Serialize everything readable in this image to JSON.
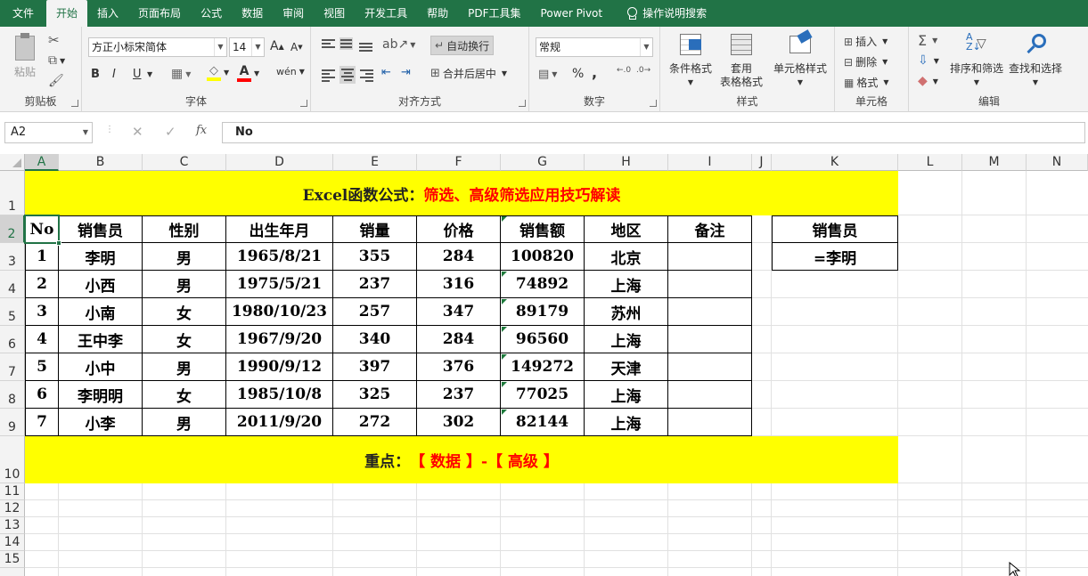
{
  "tabs": [
    "文件",
    "开始",
    "插入",
    "页面布局",
    "公式",
    "数据",
    "审阅",
    "视图",
    "开发工具",
    "帮助",
    "PDF工具集",
    "Power Pivot"
  ],
  "tellme": "操作说明搜索",
  "ribbon": {
    "clipboard": {
      "paste": "粘贴",
      "label": "剪贴板"
    },
    "font": {
      "name": "方正小标宋简体",
      "size": "14",
      "bold": "B",
      "italic": "I",
      "underline": "U",
      "grow": "A",
      "shrink": "A",
      "wen": "wén",
      "label": "字体"
    },
    "align": {
      "wrap": "自动换行",
      "merge": "合并后居中",
      "label": "对齐方式"
    },
    "number": {
      "format": "常规",
      "label": "数字",
      "percent": "%",
      "comma": ","
    },
    "styles": {
      "cond": "条件格式",
      "table1": "套用",
      "table2": "表格格式",
      "cell": "单元格样式",
      "label": "样式"
    },
    "cells": {
      "insert": "插入",
      "delete": "删除",
      "format": "格式",
      "label": "单元格"
    },
    "edit": {
      "sort": "排序和筛选",
      "find": "查找和选择",
      "label": "编辑"
    }
  },
  "formula_bar": {
    "namebox": "A2",
    "fx": "fx",
    "value": "No"
  },
  "columns": [
    "A",
    "B",
    "C",
    "D",
    "E",
    "F",
    "G",
    "H",
    "I",
    "J",
    "K",
    "L",
    "M",
    "N"
  ],
  "rows": [
    "1",
    "2",
    "3",
    "4",
    "5",
    "6",
    "7",
    "8",
    "9",
    "10",
    "11",
    "12",
    "13",
    "14",
    "15"
  ],
  "sheet": {
    "title_black": "Excel函数公式：",
    "title_red": "筛选、高级筛选应用技巧解读",
    "headers": [
      "No",
      "销售员",
      "性别",
      "出生年月",
      "销量",
      "价格",
      "销售额",
      "地区",
      "备注"
    ],
    "data": [
      [
        "1",
        "李明",
        "男",
        "1965/8/21",
        "355",
        "284",
        "100820",
        "北京",
        ""
      ],
      [
        "2",
        "小西",
        "男",
        "1975/5/21",
        "237",
        "316",
        "74892",
        "上海",
        ""
      ],
      [
        "3",
        "小南",
        "女",
        "1980/10/23",
        "257",
        "347",
        "89179",
        "苏州",
        ""
      ],
      [
        "4",
        "王中李",
        "女",
        "1967/9/20",
        "340",
        "284",
        "96560",
        "上海",
        ""
      ],
      [
        "5",
        "小中",
        "男",
        "1990/9/12",
        "397",
        "376",
        "149272",
        "天津",
        ""
      ],
      [
        "6",
        "李明明",
        "女",
        "1985/10/8",
        "325",
        "237",
        "77025",
        "上海",
        ""
      ],
      [
        "7",
        "小李",
        "男",
        "2011/9/20",
        "272",
        "302",
        "82144",
        "上海",
        ""
      ]
    ],
    "criteria_header": "销售员",
    "criteria_value": "=李明",
    "note_black": "重点：",
    "note_red": "【 数据 】-【 高级 】"
  },
  "colors": {
    "accent": "#217346",
    "highlight": "#ffff00",
    "red": "#ff0000"
  }
}
